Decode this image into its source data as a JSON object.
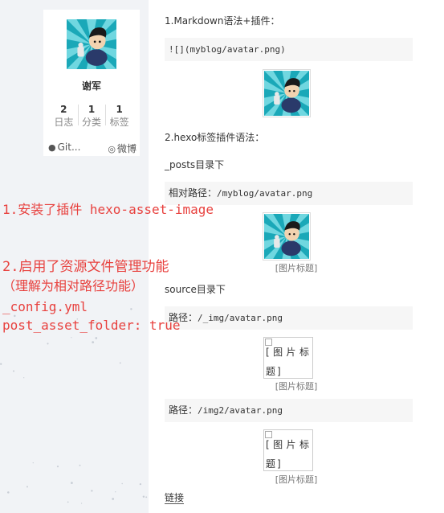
{
  "profile": {
    "name": "谢军",
    "stats": [
      {
        "num": "2",
        "label": "日志"
      },
      {
        "num": "1",
        "label": "分类"
      },
      {
        "num": "1",
        "label": "标签"
      }
    ],
    "links": [
      {
        "icon": "github-icon",
        "label": "Git..."
      },
      {
        "icon": "weibo-icon",
        "label": "微博"
      }
    ]
  },
  "post": {
    "p1": "1.Markdown语法+插件：",
    "code1": "![](myblog/avatar.png)",
    "p2": "2.hexo标签插件语法：",
    "p3": "_posts目录下",
    "code2_label": "相对路径：",
    "code2_path": "/myblog/avatar.png",
    "caption1": "[图片标题]",
    "p4": "source目录下",
    "code3_label": "路径：",
    "code3_path": "/_img/avatar.png",
    "broken1": "[图片标题]",
    "caption2": "[图片标题]",
    "code4_label": "路径：",
    "code4_path": "/img2/avatar.png",
    "broken2": "[图片标题]",
    "caption3": "[图片标题]",
    "link": "链接"
  },
  "annotations": {
    "line1": "1.安装了插件 hexo-asset-image",
    "line2": "2.启用了资源文件管理功能",
    "line3": "（理解为相对路径功能）",
    "line4": "_config.yml",
    "line5": "post_asset_folder: true"
  },
  "colors": {
    "annotation": "#e8413e",
    "background": "#f1f3f6",
    "avatar_bg": "#1aa8b8"
  }
}
